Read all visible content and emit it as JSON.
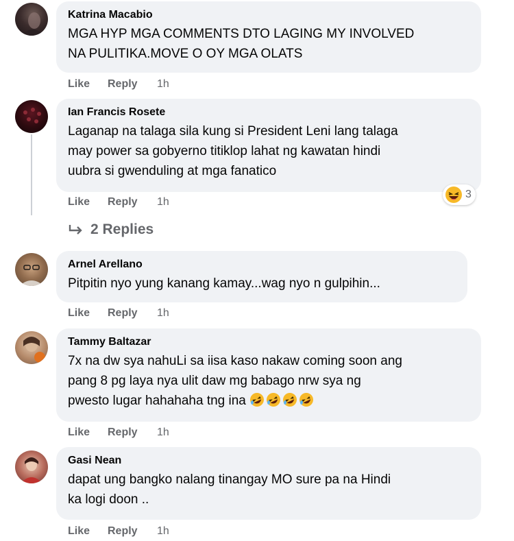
{
  "comments": [
    {
      "name": "Katrina Macabio",
      "text": "MGA HYP MGA COMMENTS DTO LAGING MY INVOLVED\nNA PULITIKA.MOVE O OY MGA OLATS",
      "like": "Like",
      "reply": "Reply",
      "time": "1h",
      "avatar": "avatar-photo"
    },
    {
      "name": "Ian Francis Rosete",
      "text": "Laganap na talaga sila kung si President Leni lang talaga\nmay power sa gobyerno titiklop lahat ng kawatan hindi\nuubra si gwenduling at mga fanatico",
      "like": "Like",
      "reply": "Reply",
      "time": "1h",
      "avatar": "avatar-photo",
      "reaction": {
        "icon": "laughing-face-icon",
        "count": "3"
      },
      "replies_label": "2 Replies"
    },
    {
      "name": "Arnel Arellano",
      "text": "Pitpitin nyo yung kanang kamay...wag nyo n gulpihin...",
      "like": "Like",
      "reply": "Reply",
      "time": "1h",
      "avatar": "avatar-photo"
    },
    {
      "name": "Tammy Baltazar",
      "text": "7x na dw sya nahuLi sa iisa kaso nakaw coming soon ang\npang 8 pg laya nya ulit daw mg babago nrw sya ng\npwesto lugar hahahaha tng ina ",
      "emojis": [
        "rofl-emoji",
        "rofl-emoji",
        "rofl-emoji",
        "rofl-emoji"
      ],
      "like": "Like",
      "reply": "Reply",
      "time": "1h",
      "avatar": "avatar-photo"
    },
    {
      "name": "Gasi Nean",
      "text": "dapat ung bangko nalang tinangay MO sure pa na Hindi\nka logi doon ..",
      "like": "Like",
      "reply": "Reply",
      "time": "1h",
      "avatar": "avatar-photo"
    }
  ],
  "colors": {
    "bubble": "#f0f2f5",
    "meta": "#65676b",
    "text": "#050505"
  }
}
